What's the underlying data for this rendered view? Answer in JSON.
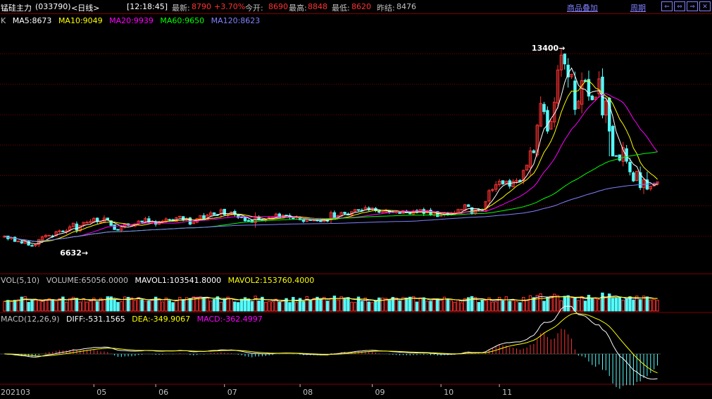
{
  "header": {
    "title": "锰硅主力",
    "code": "(033790)",
    "period": "<日线>",
    "time": "[12:18:45]",
    "last_label": "最新:",
    "last_value": "8790",
    "change": "+3.70%",
    "open_label": "今开:",
    "open_value": "8690",
    "high_label": "最高:",
    "high_value": "8848",
    "low_label": "最低:",
    "low_value": "8620",
    "prev_label": "昨结:",
    "prev_value": "8476",
    "overlay_link": "商品叠加",
    "cycle_link": "周期",
    "window_buttons": [
      "⇐",
      "⇔",
      "⇒",
      "✕"
    ]
  },
  "ma_legend": {
    "prefix": "K",
    "items": [
      {
        "text": "MA5:8673",
        "color": "#ffffff"
      },
      {
        "text": "MA10:9049",
        "color": "#ffff00"
      },
      {
        "text": "MA20:9939",
        "color": "#ff00ff"
      },
      {
        "text": "MA60:9650",
        "color": "#00ff00"
      },
      {
        "text": "MA120:8623",
        "color": "#8080ff"
      }
    ]
  },
  "vol_legend": {
    "items": [
      {
        "text": "VOL(5,10)",
        "color": "#c0c0c0"
      },
      {
        "text": "VOLUME:65056.0000",
        "color": "#c0c0c0"
      },
      {
        "text": "MAVOL1:103541.8000",
        "color": "#ffffff"
      },
      {
        "text": "MAVOL2:153760.4000",
        "color": "#ffff00"
      }
    ]
  },
  "macd_legend": {
    "items": [
      {
        "text": "MACD(12,26,9)",
        "color": "#c0c0c0"
      },
      {
        "text": "DIFF:-531.1565",
        "color": "#ffffff"
      },
      {
        "text": "DEA:-349.9067",
        "color": "#ffff00"
      },
      {
        "text": "MACD:-362.4997",
        "color": "#ff00ff"
      }
    ]
  },
  "colors": {
    "up": "#ff3232",
    "down": "#54fcfc",
    "grid": "#800000",
    "axis": "#c0c0c0",
    "text": "#c0c0c0"
  },
  "chart_data": {
    "type": "candlestick",
    "x_labels": [
      "202103",
      "05",
      "06",
      "07",
      "08",
      "09",
      "10",
      "11"
    ],
    "price_range": [
      6300,
      13800
    ],
    "high_mark": "13400",
    "low_mark": "6632",
    "ma_names": [
      "MA5",
      "MA10",
      "MA20",
      "MA60",
      "MA120"
    ],
    "closes": [
      7010,
      6920,
      6960,
      6830,
      6840,
      6780,
      6830,
      6710,
      6690,
      6740,
      6890,
      6980,
      7030,
      7030,
      6990,
      7150,
      7180,
      7150,
      7180,
      7310,
      7430,
      7200,
      7350,
      7460,
      7460,
      7490,
      7590,
      7480,
      7470,
      7600,
      7540,
      7360,
      7220,
      7200,
      7330,
      7400,
      7360,
      7350,
      7410,
      7500,
      7470,
      7580,
      7470,
      7470,
      7400,
      7470,
      7500,
      7570,
      7540,
      7500,
      7610,
      7660,
      7550,
      7580,
      7400,
      7460,
      7580,
      7680,
      7540,
      7700,
      7770,
      7710,
      7710,
      7870,
      7710,
      7710,
      7800,
      7710,
      7620,
      7620,
      7510,
      7520,
      7460,
      7650,
      7540,
      7540,
      7560,
      7620,
      7620,
      7730,
      7620,
      7690,
      7680,
      7620,
      7600,
      7640,
      7540,
      7490,
      7560,
      7540,
      7530,
      7520,
      7500,
      7560,
      7500,
      7780,
      7600,
      7680,
      7780,
      7750,
      7700,
      7810,
      7880,
      7860,
      7850,
      7940,
      7870,
      7930,
      7840,
      7790,
      7810,
      7850,
      7800,
      7790,
      7810,
      7750,
      7840,
      7770,
      7750,
      7830,
      7780,
      7880,
      7750,
      7850,
      7700,
      7790,
      7650,
      7710,
      7760,
      7710,
      7750,
      7760,
      7880,
      7880,
      8040,
      7980,
      7760,
      7870,
      7870,
      7850,
      8140,
      8500,
      8540,
      8700,
      8810,
      8720,
      8810,
      8650,
      8810,
      8840,
      8800,
      9170,
      9340,
      9810,
      9750,
      10650,
      11370,
      11100,
      10460,
      10780,
      11410,
      12470,
      12960,
      12670,
      12240,
      12330,
      11170,
      11440,
      12120,
      12090,
      11610,
      11490,
      11580,
      12180,
      10990,
      11450,
      10460,
      9640,
      9650,
      9500,
      9920,
      9470,
      9120,
      8820,
      9140,
      8600,
      8860,
      8550,
      8650,
      8710,
      8790
    ],
    "volume_max": 350000,
    "macd_range": [
      -650,
      680
    ]
  }
}
